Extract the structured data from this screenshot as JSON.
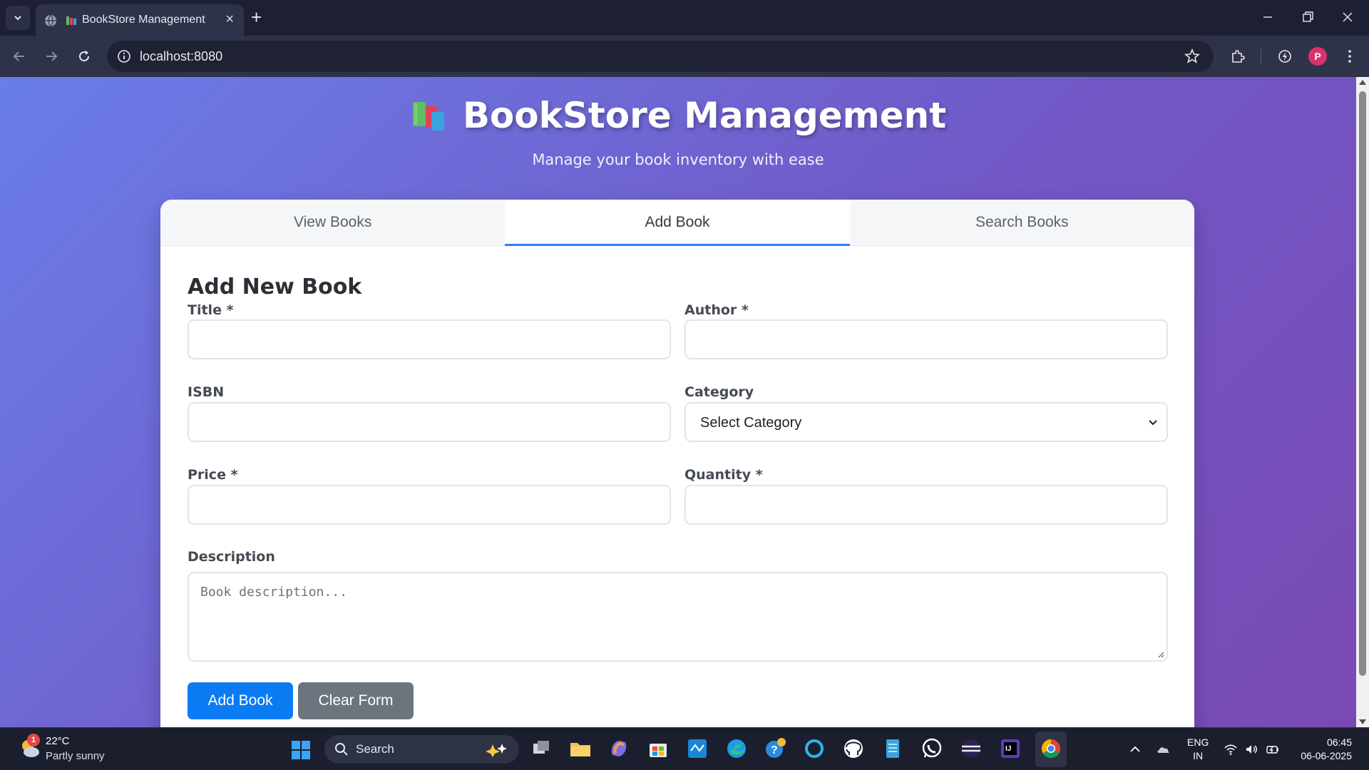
{
  "browser": {
    "tab_title": "BookStore Management",
    "address": "localhost:8080",
    "profile_initial": "P"
  },
  "app": {
    "title": "BookStore Management",
    "subtitle": "Manage your book inventory with ease",
    "tabs": [
      {
        "label": "View Books",
        "active": false
      },
      {
        "label": "Add Book",
        "active": true
      },
      {
        "label": "Search Books",
        "active": false
      }
    ],
    "form": {
      "heading": "Add New Book",
      "title_label": "Title *",
      "author_label": "Author *",
      "isbn_label": "ISBN",
      "category_label": "Category",
      "category_selected": "Select Category",
      "price_label": "Price *",
      "quantity_label": "Quantity *",
      "description_label": "Description",
      "description_placeholder": "Book description...",
      "submit_label": "Add Book",
      "clear_label": "Clear Form"
    }
  },
  "taskbar": {
    "weather_badge": "1",
    "weather_temp": "22°C",
    "weather_desc": "Partly sunny",
    "search_text": "Search",
    "lang_line1": "ENG",
    "lang_line2": "IN",
    "time": "06:45",
    "date": "06-06-2025"
  },
  "colors": {
    "accent": "#2f7ff0",
    "primary_button": "#0b7bf3",
    "secondary_button": "#6c757d",
    "gradient_start": "#6a7de8",
    "gradient_end": "#7a4ab4"
  }
}
